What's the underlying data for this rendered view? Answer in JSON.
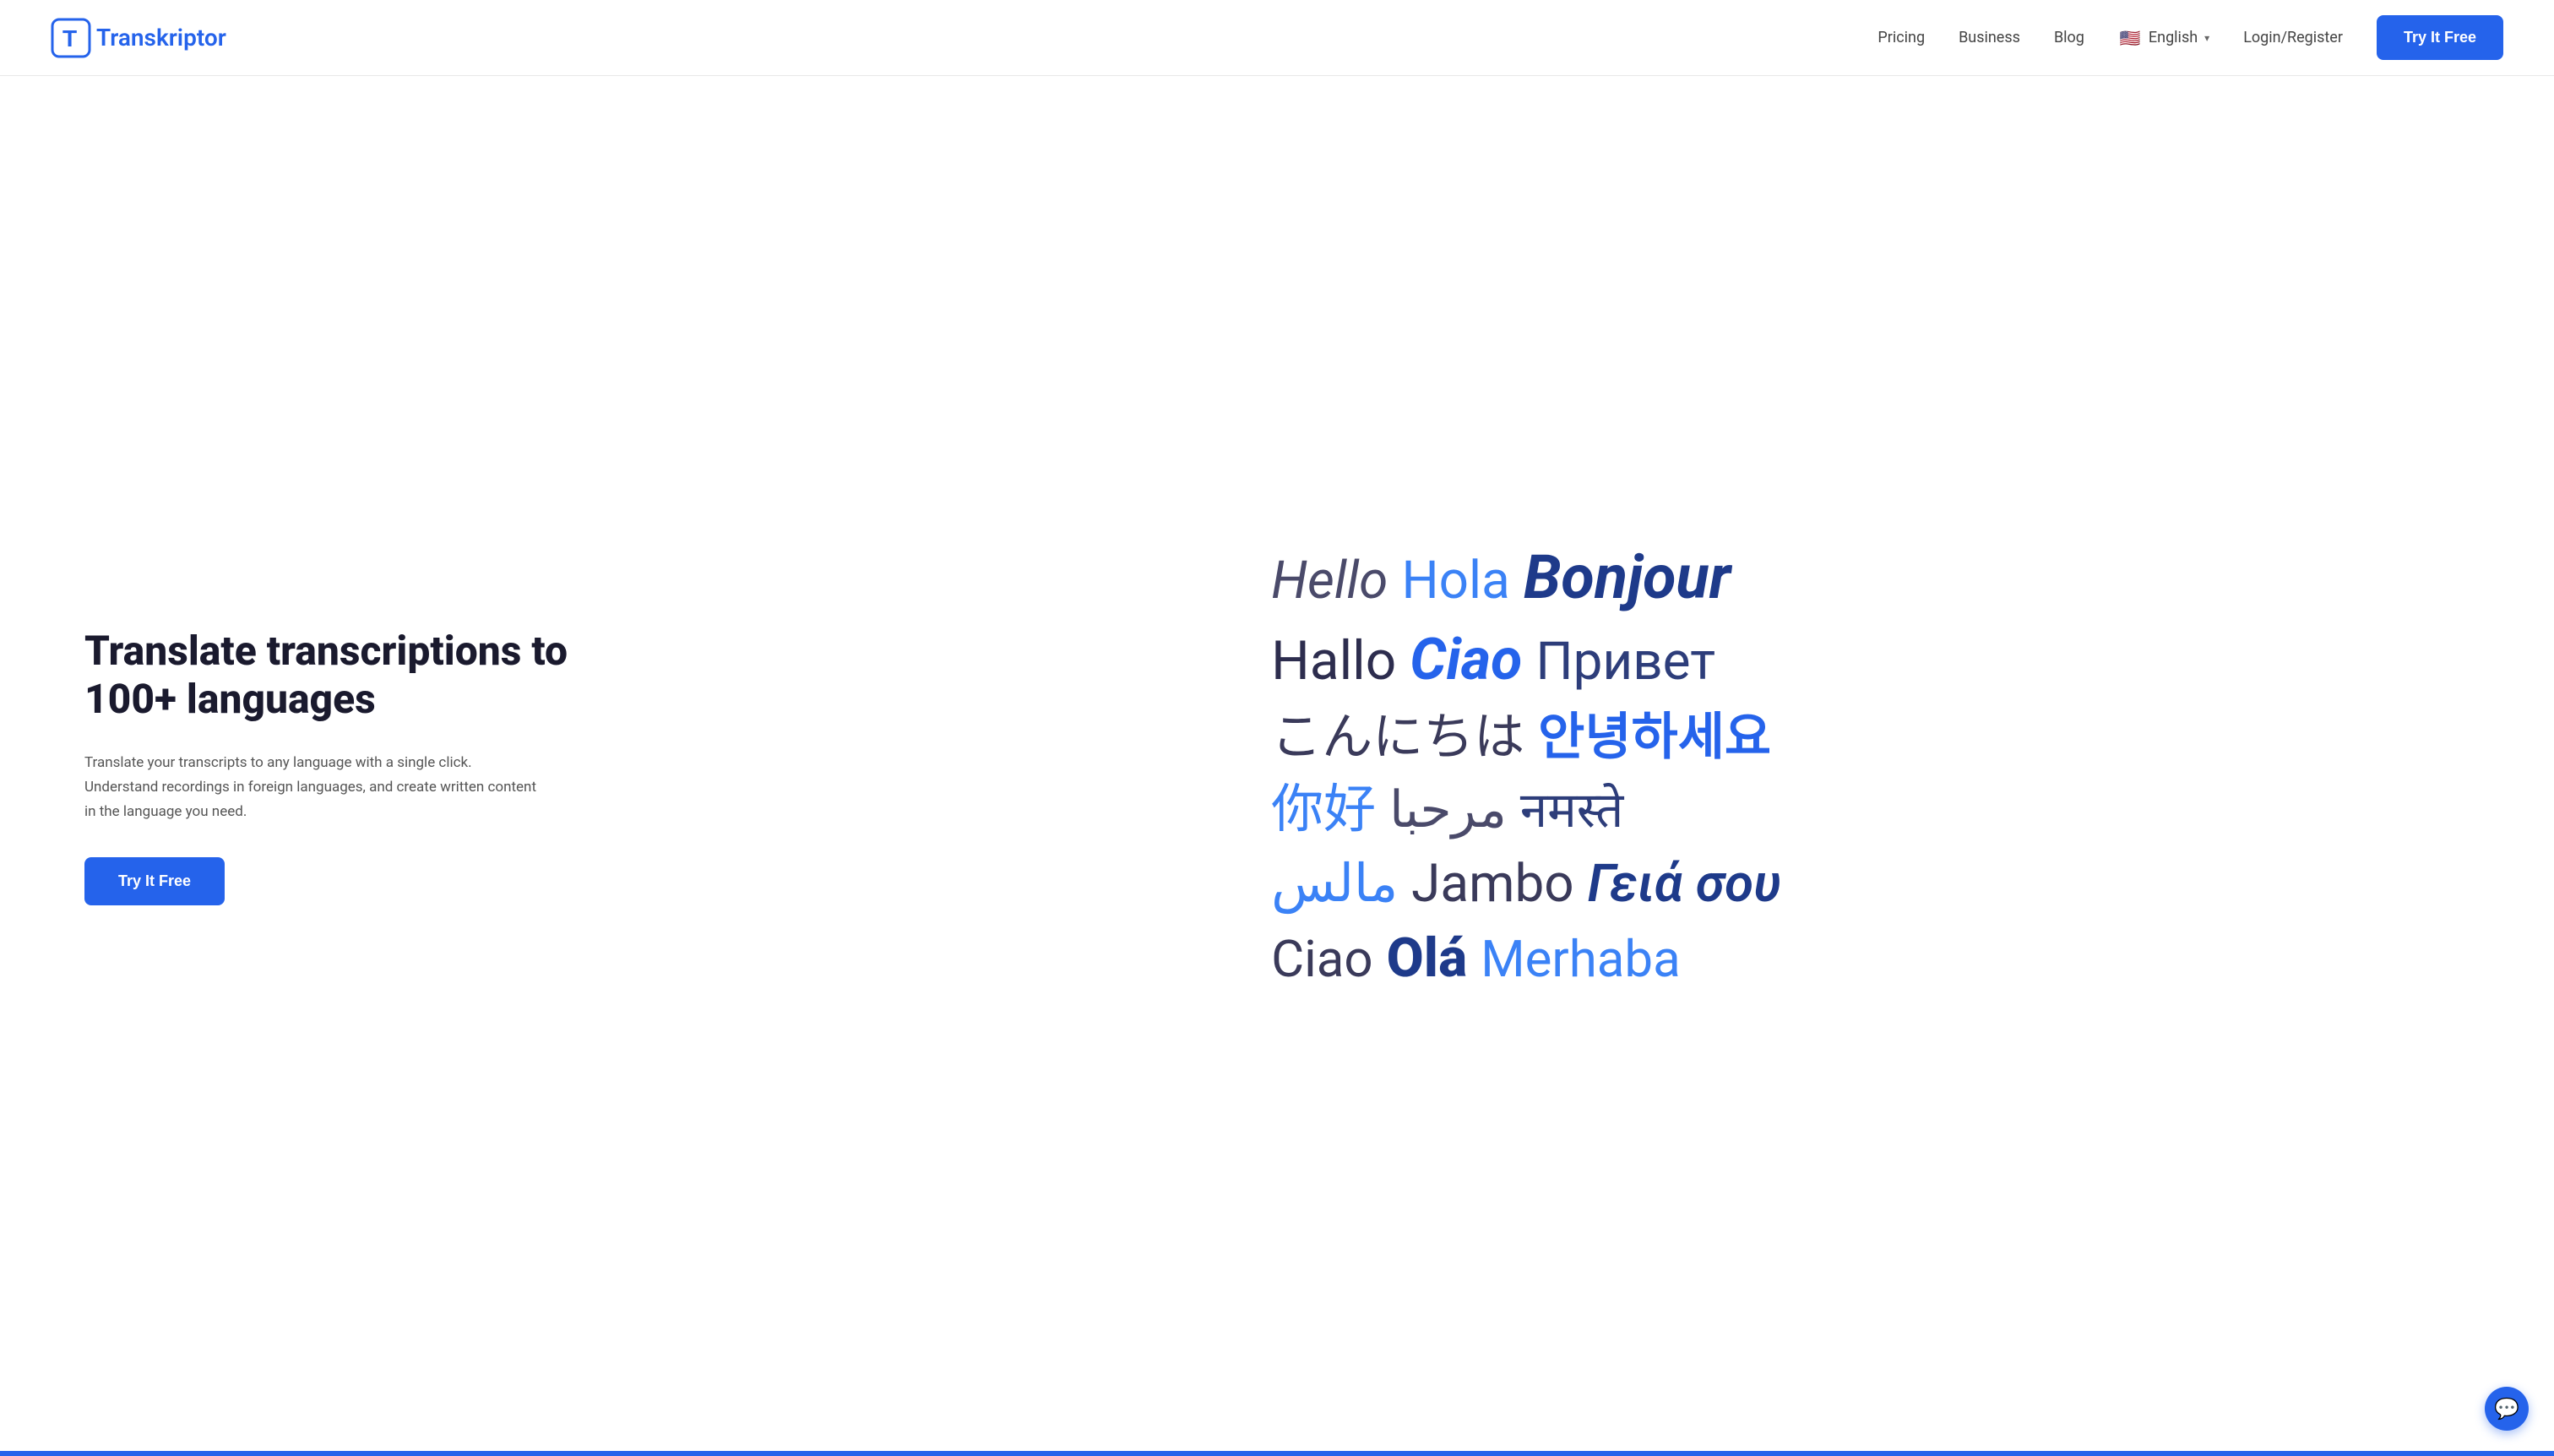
{
  "navbar": {
    "logo_text_prefix": "T",
    "logo_text_suffix": "ranskriptor",
    "nav_items": [
      {
        "id": "pricing",
        "label": "Pricing"
      },
      {
        "id": "business",
        "label": "Business"
      },
      {
        "id": "blog",
        "label": "Blog"
      }
    ],
    "language": {
      "label": "English",
      "flag_emoji": "🇺🇸",
      "chevron": "▼"
    },
    "login_label": "Login/Register",
    "try_free_label": "Try It Free"
  },
  "hero": {
    "title": "Translate transcriptions to 100+ languages",
    "subtitle": "Translate your transcripts to any language with a single click. Understand recordings in foreign languages, and create written content in the language you need.",
    "cta_label": "Try It Free"
  },
  "language_cloud": {
    "rows": [
      [
        {
          "text": "Hello",
          "style": "hello"
        },
        {
          "text": "Hola",
          "style": "hola"
        },
        {
          "text": "Bonjour",
          "style": "bonjour"
        }
      ],
      [
        {
          "text": "Hallo",
          "style": "hallo"
        },
        {
          "text": "Ciao",
          "style": "ciao"
        },
        {
          "text": "Привет",
          "style": "privet"
        }
      ],
      [
        {
          "text": "こんにちは",
          "style": "konnichiwa"
        },
        {
          "text": "안녕하세요",
          "style": "annyeong"
        }
      ],
      [
        {
          "text": "你好",
          "style": "nihao"
        },
        {
          "text": "مرحبا",
          "style": "marhaba"
        },
        {
          "text": "नमस्ते",
          "style": "namaste"
        }
      ],
      [
        {
          "text": "مالس",
          "style": "salam"
        },
        {
          "text": "Jambo",
          "style": "jambo"
        },
        {
          "text": "Γειά σου",
          "style": "yiasou"
        }
      ],
      [
        {
          "text": "Ciao",
          "style": "ciao2"
        },
        {
          "text": "Olá",
          "style": "ola"
        },
        {
          "text": "Merhaba",
          "style": "merhaba"
        }
      ]
    ]
  },
  "chat_bubble": {
    "icon": "💬"
  }
}
